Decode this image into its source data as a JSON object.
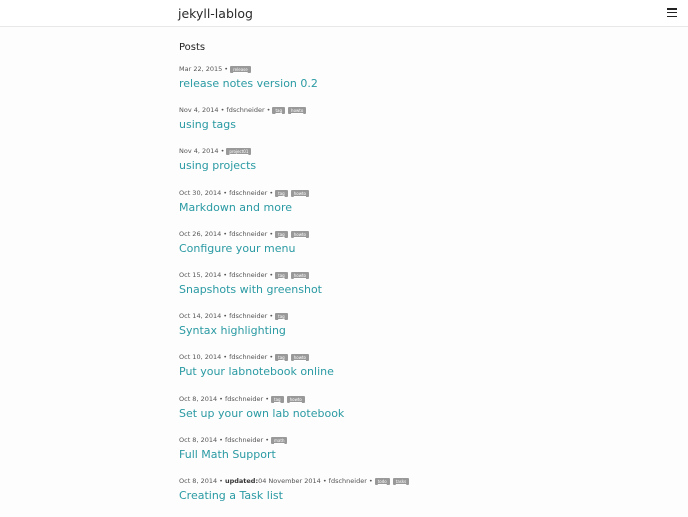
{
  "header": {
    "site_title": "jekyll-lablog",
    "menu_icon": "hamburger-icon"
  },
  "main": {
    "heading": "Posts",
    "posts": [
      {
        "date": "Mar 22, 2015",
        "updated_label": "",
        "updated": "",
        "author": "",
        "tags": [
          "release"
        ],
        "title": "release notes version 0.2"
      },
      {
        "date": "Nov 4, 2014",
        "updated_label": "",
        "updated": "",
        "author": "fdschneider",
        "tags": [
          "tag",
          "howto"
        ],
        "title": "using tags"
      },
      {
        "date": "Nov 4, 2014",
        "updated_label": "",
        "updated": "",
        "author": "",
        "tags": [
          "project01"
        ],
        "title": "using projects"
      },
      {
        "date": "Oct 30, 2014",
        "updated_label": "",
        "updated": "",
        "author": "fdschneider",
        "tags": [
          "tag",
          "howto"
        ],
        "title": "Markdown and more"
      },
      {
        "date": "Oct 26, 2014",
        "updated_label": "",
        "updated": "",
        "author": "fdschneider",
        "tags": [
          "tag",
          "howto"
        ],
        "title": "Configure your menu"
      },
      {
        "date": "Oct 15, 2014",
        "updated_label": "",
        "updated": "",
        "author": "fdschneider",
        "tags": [
          "tag",
          "howto"
        ],
        "title": "Snapshots with greenshot"
      },
      {
        "date": "Oct 14, 2014",
        "updated_label": "",
        "updated": "",
        "author": "fdschneider",
        "tags": [
          "tag"
        ],
        "title": "Syntax highlighting"
      },
      {
        "date": "Oct 10, 2014",
        "updated_label": "",
        "updated": "",
        "author": "fdschneider",
        "tags": [
          "tag",
          "howto"
        ],
        "title": "Put your labnotebook online"
      },
      {
        "date": "Oct 8, 2014",
        "updated_label": "",
        "updated": "",
        "author": "fdschneider",
        "tags": [
          "tag",
          "howto"
        ],
        "title": "Set up your own lab notebook"
      },
      {
        "date": "Oct 8, 2014",
        "updated_label": "",
        "updated": "",
        "author": "fdschneider",
        "tags": [
          "math"
        ],
        "title": "Full Math Support"
      },
      {
        "date": "Oct 8, 2014",
        "updated_label": "updated:",
        "updated": "04 November 2014",
        "author": "fdschneider",
        "tags": [
          "todo",
          "tasks"
        ],
        "title": "Creating a Task list"
      }
    ]
  },
  "colors": {
    "link": "#2a9aa3",
    "tag_bg": "#999999"
  }
}
